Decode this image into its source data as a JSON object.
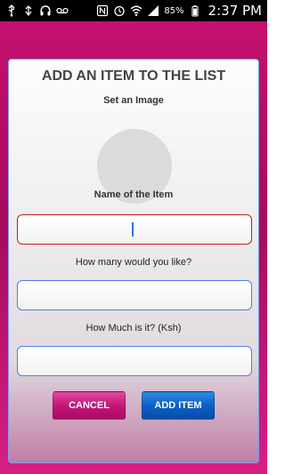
{
  "status_bar": {
    "left_icons": [
      "usb-icon",
      "sync-icon",
      "headset-icon",
      "voicemail-icon"
    ],
    "right_icons": [
      "nfc-icon",
      "alarm-icon",
      "wifi-icon",
      "signal-icon",
      "battery-icon"
    ],
    "battery": "85%",
    "time": "2:37 PM"
  },
  "form": {
    "title": "ADD AN ITEM TO THE LIST",
    "image_label": "Set an Image",
    "name_label": "Name of the Item",
    "name_value": "",
    "quantity_label": "How many would you like?",
    "quantity_value": "",
    "price_label": "How Much is it? (Ksh)",
    "price_value": ""
  },
  "buttons": {
    "cancel": "CANCEL",
    "add": "ADD ITEM"
  },
  "colors": {
    "background": "#c5106f",
    "cancel_button": "#c41578",
    "add_button": "#0b5fc7",
    "active_field_border": "#c8191f",
    "field_border": "#4d7ee8"
  }
}
